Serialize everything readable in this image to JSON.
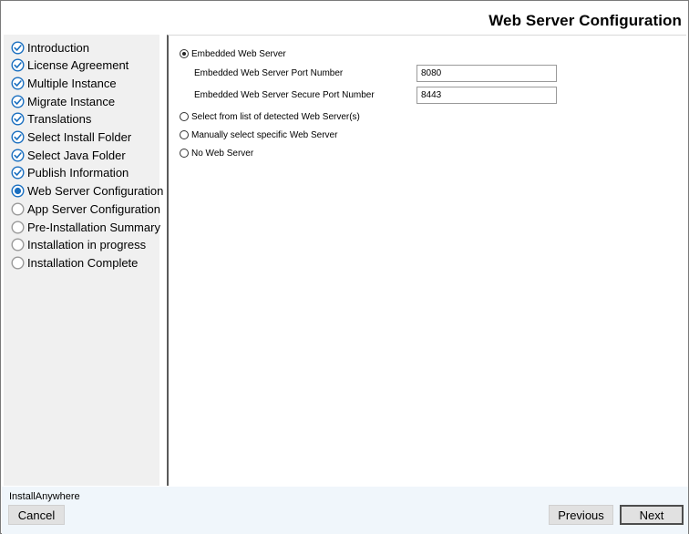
{
  "header": {
    "title": "Web Server Configuration"
  },
  "steps": [
    {
      "label": "Introduction",
      "state": "done"
    },
    {
      "label": "License Agreement",
      "state": "done"
    },
    {
      "label": "Multiple Instance",
      "state": "done"
    },
    {
      "label": "Migrate Instance",
      "state": "done"
    },
    {
      "label": "Translations",
      "state": "done"
    },
    {
      "label": "Select Install Folder",
      "state": "done"
    },
    {
      "label": "Select Java Folder",
      "state": "done"
    },
    {
      "label": "Publish Information",
      "state": "done"
    },
    {
      "label": "Web Server Configuration",
      "state": "current"
    },
    {
      "label": "App Server Configuration",
      "state": "pending"
    },
    {
      "label": "Pre-Installation Summary",
      "state": "pending"
    },
    {
      "label": "Installation in progress",
      "state": "pending"
    },
    {
      "label": "Installation Complete",
      "state": "pending"
    }
  ],
  "options": {
    "embedded": "Embedded Web Server",
    "detected": "Select from list of detected Web Server(s)",
    "manual": "Manually select specific Web Server",
    "none": "No Web Server",
    "selected": "embedded"
  },
  "fields": {
    "port_label": "Embedded Web Server Port Number",
    "port_value": "8080",
    "secure_port_label": "Embedded Web Server Secure Port Number",
    "secure_port_value": "8443"
  },
  "footer": {
    "brand": "InstallAnywhere",
    "cancel": "Cancel",
    "previous": "Previous",
    "next": "Next"
  },
  "colors": {
    "done_icon": "#1a6fc0",
    "current_icon": "#1a6fc0",
    "pending_icon": "#9a9a9a",
    "sidebar_bg": "#f0f0f0",
    "footer_bg": "#f0f6fb"
  },
  "icons": {
    "done": "check-circle-icon",
    "current": "radio-filled-icon",
    "pending": "empty-circle-icon"
  }
}
